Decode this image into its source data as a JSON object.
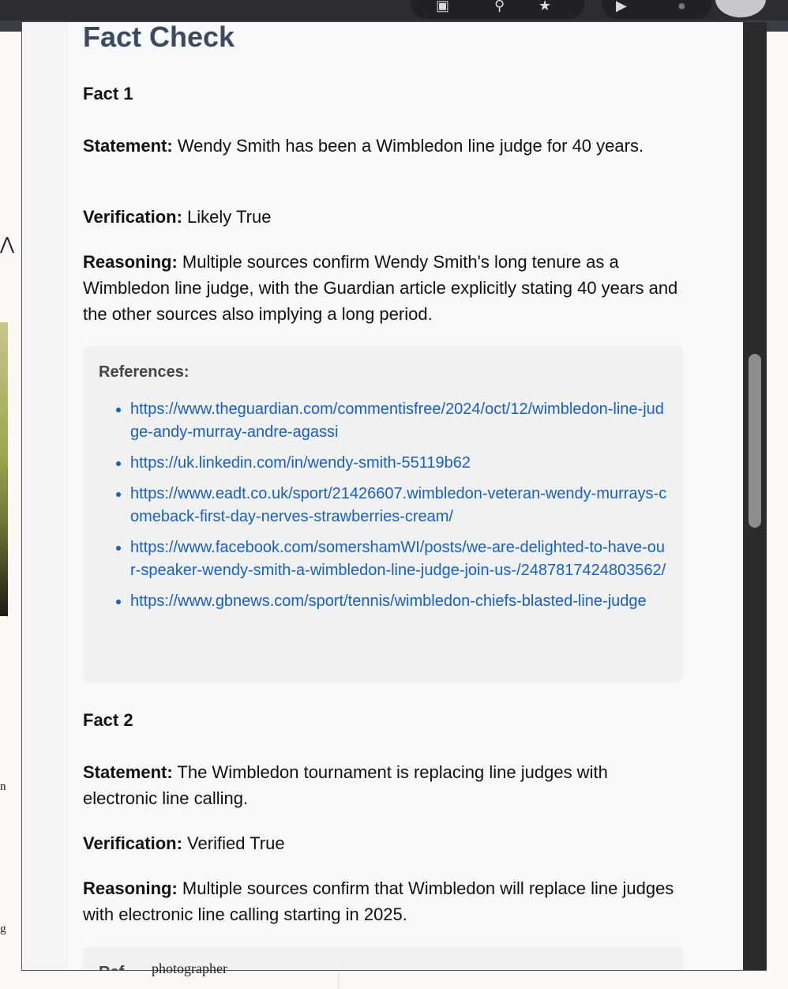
{
  "panel": {
    "title": "Fact Check"
  },
  "facts": [
    {
      "title": "Fact 1",
      "statement_label": "Statement:",
      "statement": "Wendy Smith has been a Wimbledon line judge for 40 years.",
      "verification_label": "Verification:",
      "verification": "Likely True",
      "reasoning_label": "Reasoning:",
      "reasoning": "Multiple sources confirm Wendy Smith's long tenure as a Wimbledon line judge, with the Guardian article explicitly stating 40 years and the other sources also implying a long period.",
      "references_label": "References:",
      "references": [
        "https://www.theguardian.com/commentisfree/2024/oct/12/wimbledon-line-judge-andy-murray-andre-agassi",
        "https://uk.linkedin.com/in/wendy-smith-55119b62",
        "https://www.eadt.co.uk/sport/21426607.wimbledon-veteran-wendy-murrays-comeback-first-day-nerves-strawberries-cream/",
        "https://www.facebook.com/somershamWI/posts/we-are-delighted-to-have-our-speaker-wendy-smith-a-wimbledon-line-judge-join-us-/2487817424803562/",
        "https://www.gbnews.com/sport/tennis/wimbledon-chiefs-blasted-line-judge"
      ]
    },
    {
      "title": "Fact 2",
      "statement_label": "Statement:",
      "statement": "The Wimbledon tournament is replacing line judges with electronic line calling.",
      "verification_label": "Verification:",
      "verification": "Verified True",
      "reasoning_label": "Reasoning:",
      "reasoning": "Multiple sources confirm that Wimbledon will replace line judges with electronic line calling starting in 2025.",
      "references_label": "Ref"
    }
  ],
  "background": {
    "bottom_text": "photographer",
    "side_letters": [
      "n",
      "g"
    ]
  }
}
